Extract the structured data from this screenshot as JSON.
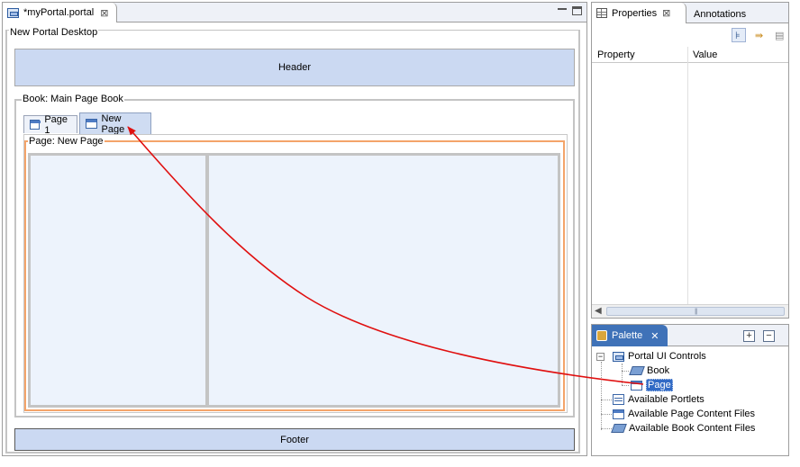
{
  "editor": {
    "tab_title": "*myPortal.portal",
    "tab_close": "⊠",
    "desktop_label": "New Portal Desktop",
    "header_label": "Header",
    "book_label": "Book: Main Page Book",
    "page_tabs": [
      {
        "label": "Page 1",
        "selected": false
      },
      {
        "label": "New Page",
        "selected": true
      }
    ],
    "page_label": "Page: New Page",
    "footer_label": "Footer"
  },
  "properties": {
    "tab_title": "Properties",
    "tab_close": "⊠",
    "annotations_tab": "Annotations",
    "columns": [
      "Property",
      "Value"
    ],
    "scroll_left": "◀",
    "scroll_grip": "|||"
  },
  "palette": {
    "tab_title": "Palette",
    "tab_close": "✕",
    "expand_all": "+",
    "collapse_all": "−",
    "tree": {
      "group_toggle": "−",
      "group_label": "Portal UI Controls",
      "children": [
        {
          "label": "Book",
          "icon": "book-icon",
          "selected": false
        },
        {
          "label": "Page",
          "icon": "page-icon",
          "selected": true
        }
      ],
      "siblings": [
        {
          "label": "Available Portlets",
          "icon": "portlet-icon"
        },
        {
          "label": "Available Page Content Files",
          "icon": "page-icon"
        },
        {
          "label": "Available Book Content Files",
          "icon": "book-icon"
        }
      ]
    }
  },
  "colors": {
    "accent": "#3f72b8",
    "region_fill": "#cbd9f2",
    "page_border": "#f4a46a",
    "annotation_arrow": "#e01010"
  }
}
